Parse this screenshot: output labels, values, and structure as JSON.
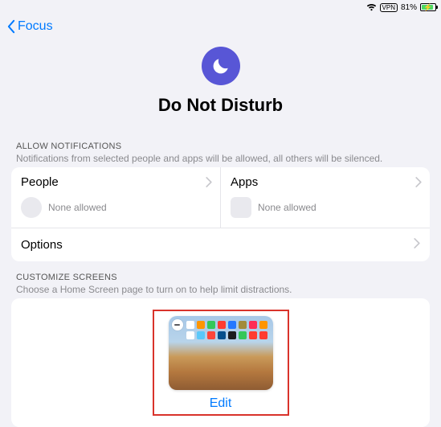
{
  "status": {
    "vpn": "VPN",
    "battery_text": "81%"
  },
  "nav": {
    "back_label": "Focus"
  },
  "header": {
    "title": "Do Not Disturb"
  },
  "notifications": {
    "section_title": "ALLOW NOTIFICATIONS",
    "section_sub": "Notifications from selected people and apps will be allowed, all others will be silenced.",
    "people_label": "People",
    "people_status": "None allowed",
    "apps_label": "Apps",
    "apps_status": "None allowed",
    "options_label": "Options"
  },
  "screens": {
    "section_title": "CUSTOMIZE SCREENS",
    "section_sub": "Choose a Home Screen page to turn on to help limit distractions.",
    "edit_label": "Edit"
  }
}
